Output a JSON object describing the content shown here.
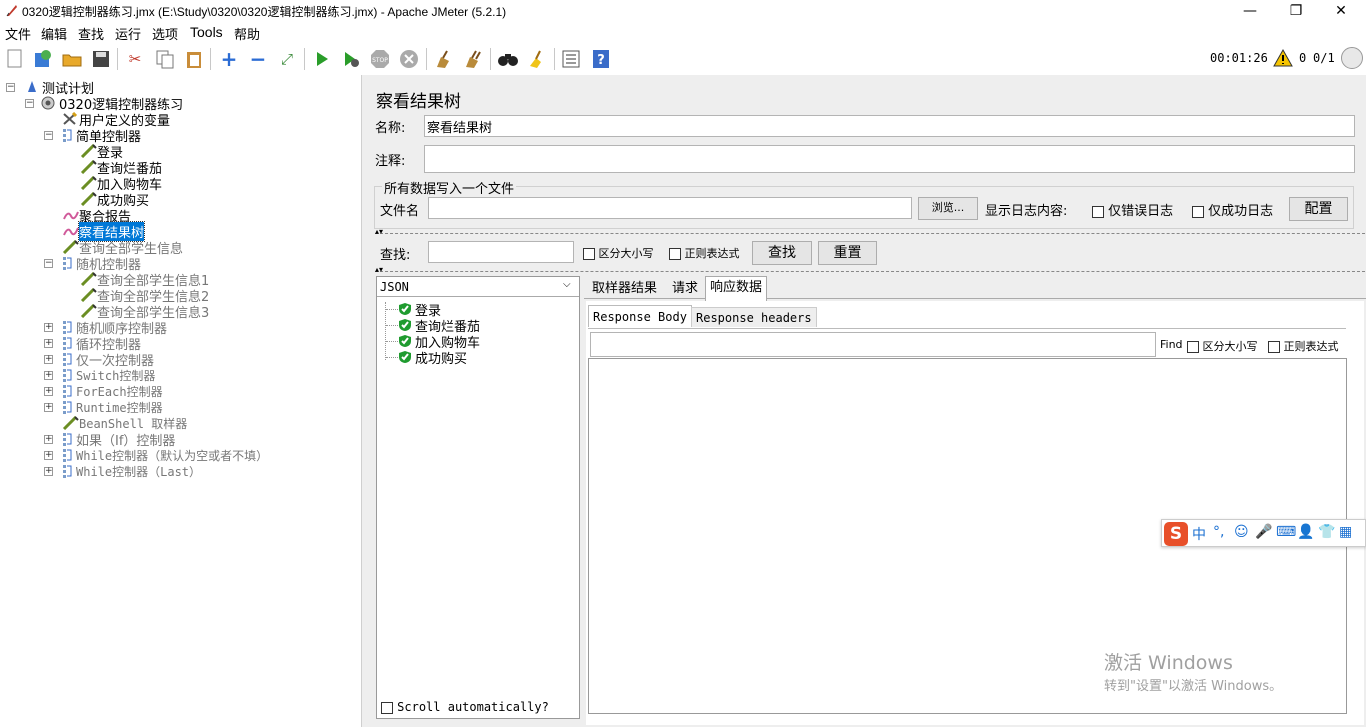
{
  "window": {
    "title": "0320逻辑控制器练习.jmx (E:\\Study\\0320\\0320逻辑控制器练习.jmx) - Apache JMeter (5.2.1)",
    "minimize": "—",
    "restore": "❐",
    "close": "✕"
  },
  "menu": [
    "文件",
    "编辑",
    "查找",
    "运行",
    "选项",
    "Tools",
    "帮助"
  ],
  "status": {
    "elapsed": "00:01:26",
    "warnings": "0",
    "threads": "0/1"
  },
  "tree": {
    "root": "测试计划",
    "plan": "0320逻辑控制器练习",
    "items": [
      {
        "label": "用户定义的变量"
      },
      {
        "label": "简单控制器"
      },
      {
        "label": "登录"
      },
      {
        "label": "查询烂番茄"
      },
      {
        "label": "加入购物车"
      },
      {
        "label": "成功购买"
      },
      {
        "label": "聚合报告"
      },
      {
        "label": "察看结果树"
      },
      {
        "label": "查询全部学生信息"
      },
      {
        "label": "随机控制器"
      },
      {
        "label": "查询全部学生信息1"
      },
      {
        "label": "查询全部学生信息2"
      },
      {
        "label": "查询全部学生信息3"
      },
      {
        "label": "随机顺序控制器"
      },
      {
        "label": "循环控制器"
      },
      {
        "label": "仅一次控制器"
      },
      {
        "label": "Switch控制器"
      },
      {
        "label": "ForEach控制器"
      },
      {
        "label": "Runtime控制器"
      },
      {
        "label": "BeanShell 取样器"
      },
      {
        "label": "如果（If）控制器"
      },
      {
        "label": "While控制器（默认为空或者不填）"
      },
      {
        "label": "While控制器（Last）"
      }
    ]
  },
  "panel": {
    "heading": "察看结果树",
    "name_label": "名称:",
    "name_value": "察看结果树",
    "comment_label": "注释:",
    "comment_value": "",
    "file_group_title": "所有数据写入一个文件",
    "filename_label": "文件名",
    "filename_value": "",
    "browse": "浏览...",
    "log_label": "显示日志内容:",
    "errors_only": "仅错误日志",
    "success_only": "仅成功日志",
    "configure": "配置",
    "search_label": "查找:",
    "search_value": "",
    "case_sensitive": "区分大小写",
    "regex": "正则表达式",
    "search_button": "查找",
    "reset_button": "重置",
    "renderer": "JSON",
    "results": [
      "登录",
      "查询烂番茄",
      "加入购物车",
      "成功购买"
    ],
    "scroll_auto": "Scroll automatically?",
    "tabs": [
      "取样器结果",
      "请求",
      "响应数据"
    ],
    "subtabs": [
      "Response Body",
      "Response headers"
    ],
    "find_label": "Find",
    "find_case": "区分大小写",
    "find_regex": "正则表达式"
  },
  "ime": {
    "items": [
      "中",
      "°,",
      "☺",
      "🎤",
      "⌨",
      "👤",
      "👕",
      "▦"
    ]
  },
  "watermark": {
    "line1": "激活 Windows",
    "line2": "转到\"设置\"以激活 Windows。"
  },
  "colors": {
    "selection": "#0078d7",
    "run": "#2a9d2a",
    "check": "#1f9b2f"
  }
}
